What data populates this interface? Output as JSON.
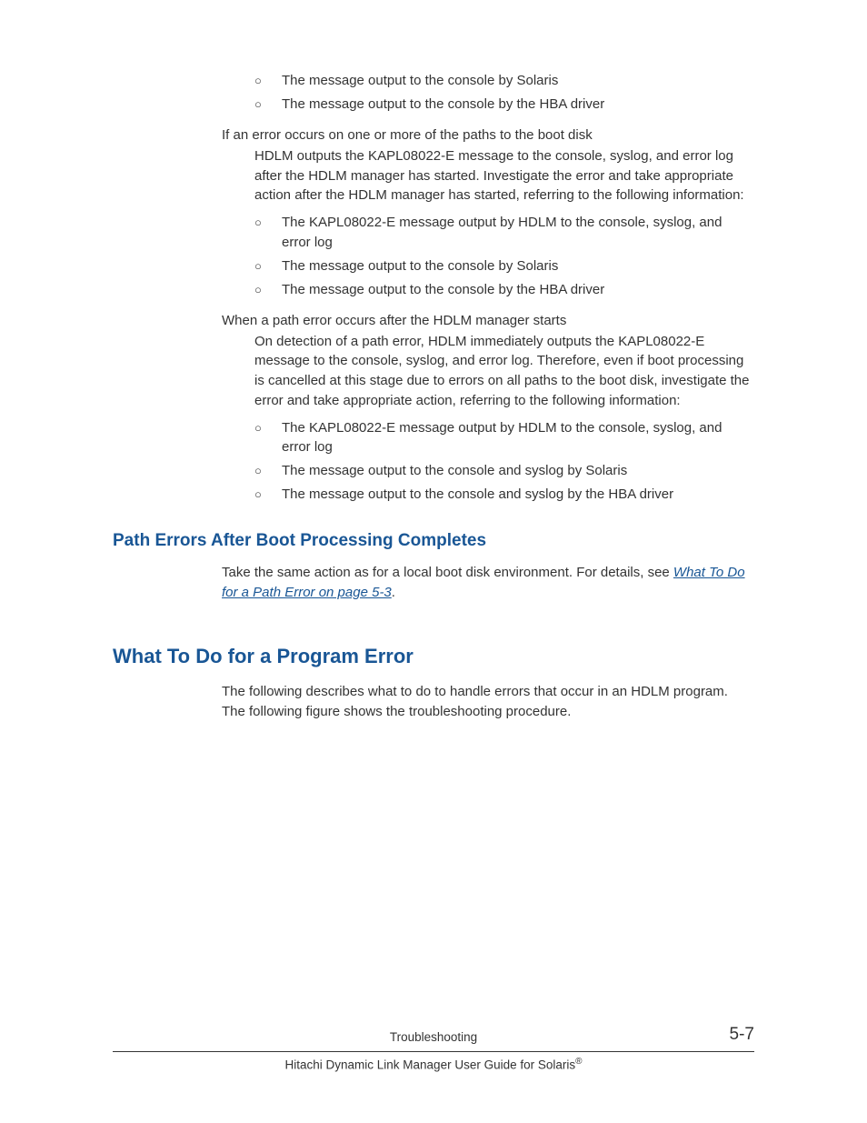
{
  "list1": {
    "items": [
      "The message output to the console by Solaris",
      "The message output to the console by the HBA driver"
    ]
  },
  "sec1": {
    "term": "If an error occurs on one or more of the paths to the boot disk",
    "def": "HDLM outputs the KAPL08022-E message to the console, syslog, and error log after the HDLM manager has started. Investigate the error and take appropriate action after the HDLM manager has started, referring to the following information:",
    "items": [
      "The KAPL08022-E message output by HDLM to the console, syslog, and error log",
      "The message output to the console by Solaris",
      "The message output to the console by the HBA driver"
    ]
  },
  "sec2": {
    "term": "When a path error occurs after the HDLM manager starts",
    "def": "On detection of a path error, HDLM immediately outputs the KAPL08022-E message to the console, syslog, and error log. Therefore, even if boot processing is cancelled at this stage due to errors on all paths to the boot disk, investigate the error and take appropriate action, referring to the following information:",
    "items": [
      "The KAPL08022-E message output by HDLM to the console, syslog, and error log",
      "The message output to the console and syslog by Solaris",
      "The message output to the console and syslog by the HBA driver"
    ]
  },
  "h3_1": "Path Errors After Boot Processing Completes",
  "h3_1_text": "Take the same action as for a local boot disk environment. For details, see ",
  "h3_1_link": "What To Do for a Path Error on page 5-3",
  "h3_1_after": ".",
  "h2_1": "What To Do for a Program Error",
  "h2_1_text": "The following describes what to do to handle errors that occur in an HDLM program. The following figure shows the troubleshooting procedure.",
  "footer": {
    "chapter": "Troubleshooting",
    "pagenum": "5-7",
    "doc_prefix": "Hitachi Dynamic Link Manager User Guide for Solaris",
    "doc_sup": "®"
  }
}
